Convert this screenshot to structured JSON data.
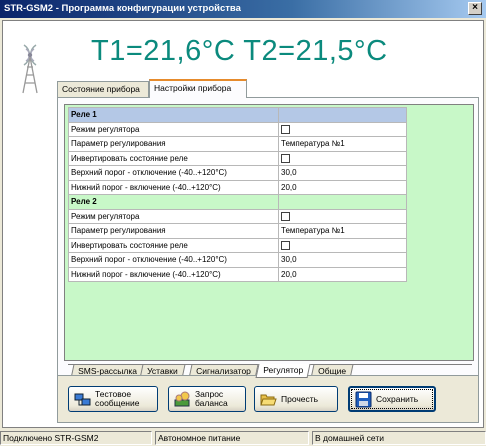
{
  "window": {
    "title": "STR-GSM2 - Программа конфигурации устройства",
    "close_glyph": "×"
  },
  "temperature": "T1=21,6°C T2=21,5°C",
  "tabs": [
    {
      "label": "Состояние прибора"
    },
    {
      "label": "Настройки прибора"
    }
  ],
  "grid": {
    "rows": [
      {
        "type": "section",
        "label": "Реле 1"
      },
      {
        "type": "check",
        "label": "Режим регулятора"
      },
      {
        "type": "value",
        "label": "Параметр регулирования",
        "value": "Температура №1"
      },
      {
        "type": "check",
        "label": "Инвертировать состояние реле"
      },
      {
        "type": "value",
        "label": "Верхний порог - отключение (-40..+120°С)",
        "value": "30,0"
      },
      {
        "type": "value",
        "label": "Нижний порог - включение (-40..+120°С)",
        "value": "20,0"
      },
      {
        "type": "section",
        "label": "Реле 2"
      },
      {
        "type": "check",
        "label": "Режим регулятора"
      },
      {
        "type": "value",
        "label": "Параметр регулирования",
        "value": "Температура №1"
      },
      {
        "type": "check",
        "label": "Инвертировать состояние реле"
      },
      {
        "type": "value",
        "label": "Верхний порог - отключение (-40..+120°С)",
        "value": "30,0"
      },
      {
        "type": "value",
        "label": "Нижний порог - включение (-40..+120°С)",
        "value": "20,0"
      }
    ]
  },
  "bottom_tabs": [
    {
      "label": "SMS-рассылка"
    },
    {
      "label": "Уставки"
    },
    {
      "label": "Сигнализатор"
    },
    {
      "label": "Регулятор"
    },
    {
      "label": "Общие"
    }
  ],
  "buttons": {
    "test_line1": "Тестовое",
    "test_line2": "сообщение",
    "balance_line1": "Запрос",
    "balance_line2": "баланса",
    "read": "Прочесть",
    "save": "Сохранить"
  },
  "status": {
    "connection": "Подключено STR-GSM2",
    "power": "Автономное питание",
    "network": "В домашней сети"
  },
  "colors": {
    "temperature": "#0b8a7d",
    "grid_background": "#c8f8c8",
    "selected_row": "#b4c8e6"
  }
}
